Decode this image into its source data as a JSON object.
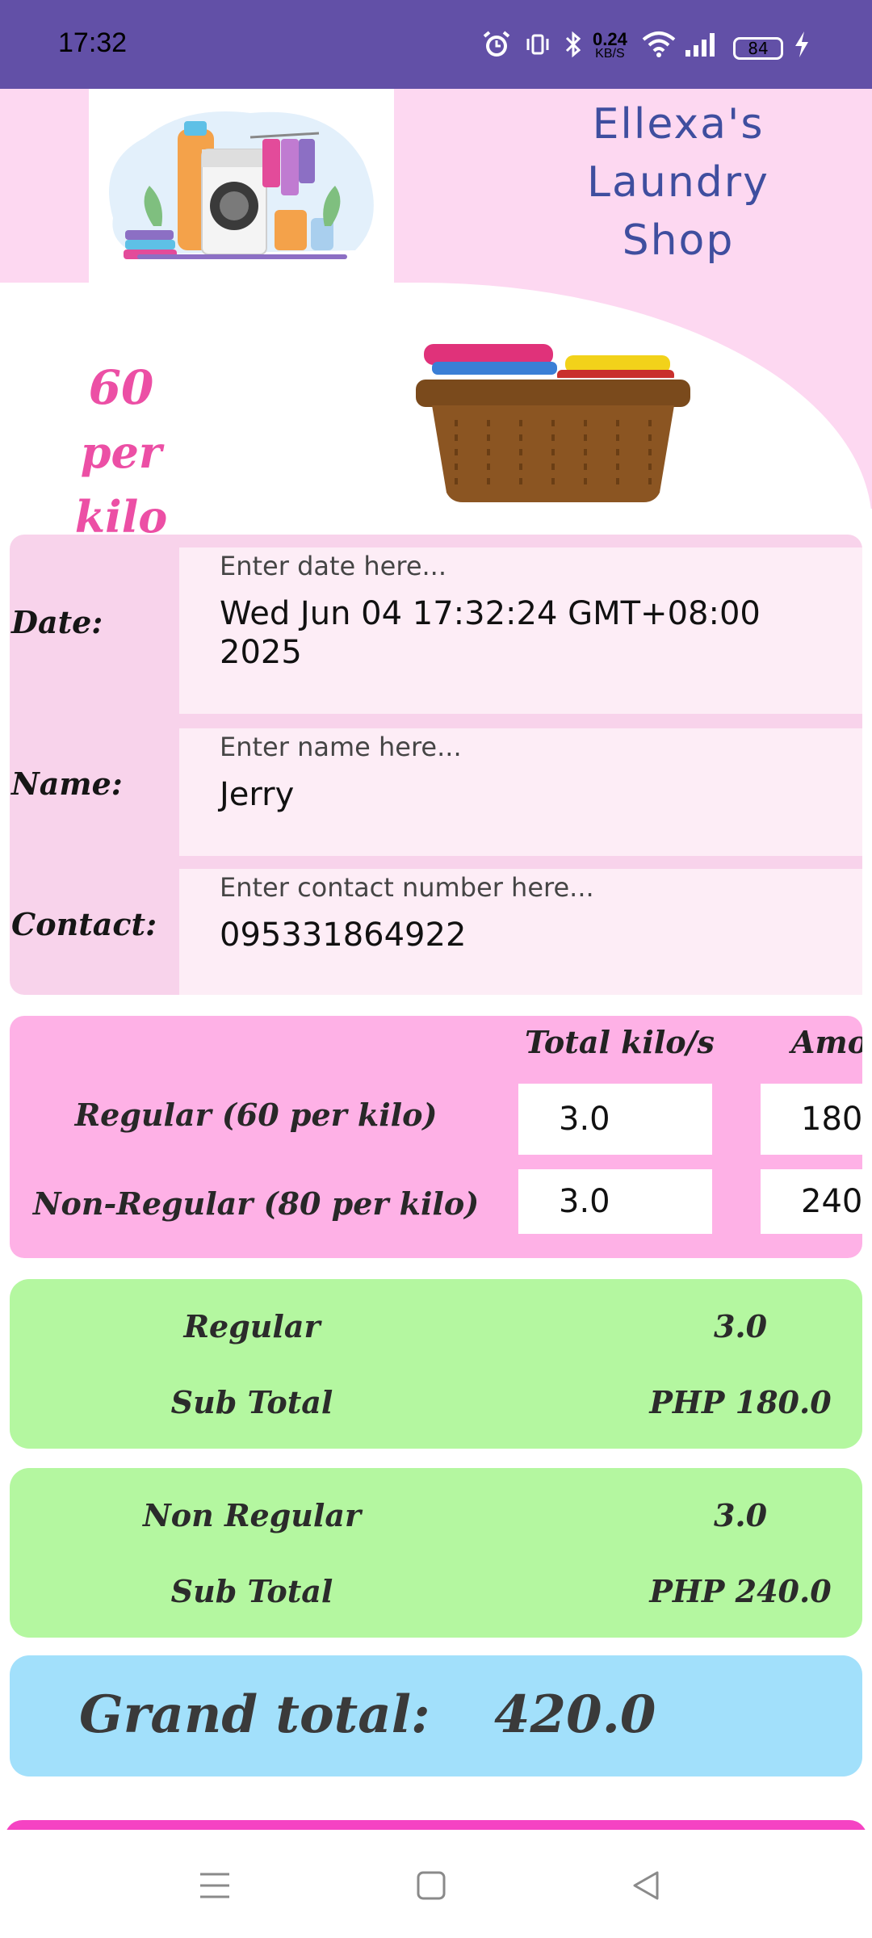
{
  "status_bar": {
    "time": "17:32",
    "net_speed_value": "0.24",
    "net_speed_unit": "KB/S",
    "battery": "84"
  },
  "header": {
    "shop_title_line1": "Ellexa's",
    "shop_title_line2": "Laundry",
    "shop_title_line3": "Shop",
    "price_value": "60",
    "price_unit": "per kilo"
  },
  "form": {
    "date_label": "Date:",
    "date_placeholder": "Enter date here...",
    "date_value_line1": "Wed Jun 04 17:32:24 GMT+08:00",
    "date_value_line2": "2025",
    "name_label": "Name:",
    "name_placeholder": "Enter name here...",
    "name_value": "Jerry",
    "contact_label": "Contact:",
    "contact_placeholder": "Enter contact number here...",
    "contact_value": "095331864922"
  },
  "kilo_table": {
    "header_total": "Total kilo/s",
    "header_amount": "Amo",
    "rows": [
      {
        "label": "Regular (60 per kilo)",
        "kilos": "3.0",
        "amount": "180"
      },
      {
        "label": "Non-Regular (80 per kilo)",
        "kilos": "3.0",
        "amount": "240"
      }
    ]
  },
  "regular_summary": {
    "title": "Regular",
    "kilos": "3.0",
    "subtotal_label": "Sub Total",
    "subtotal_value": "PHP 180.0"
  },
  "nonregular_summary": {
    "title": "Non Regular",
    "kilos": "3.0",
    "subtotal_label": "Sub Total",
    "subtotal_value": "PHP 240.0"
  },
  "grand_total": {
    "label": "Grand total:",
    "value": "420.0"
  },
  "colors": {
    "status_bar": "#6250a7",
    "header_pink": "#fdd8f1",
    "title_blue": "#3f4e9f",
    "price_pink": "#ec4fa5",
    "kilo_card": "#feb1e6",
    "subtotal_green": "#b4f7a0",
    "grand_blue": "#a2e0fb"
  },
  "icons": [
    "alarm-icon",
    "vibrate-icon",
    "bluetooth-icon",
    "wifi-icon",
    "signal-icon",
    "battery-icon",
    "charging-icon",
    "menu-icon",
    "home-icon",
    "back-icon"
  ]
}
